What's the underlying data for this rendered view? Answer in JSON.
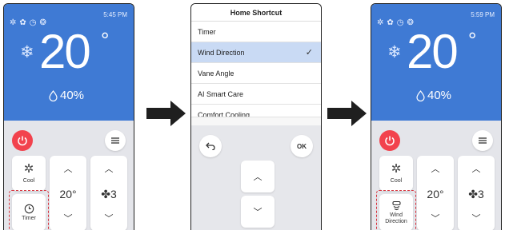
{
  "left_phone": {
    "time": "5:45 PM",
    "temperature": "20",
    "degree_symbol": "°",
    "humidity": "40%",
    "mode_label": "Cool",
    "shortcut_label": "Timer",
    "set_temp": "20°",
    "fan_speed": "3"
  },
  "middle_phone": {
    "title": "Home Shortcut",
    "items": [
      {
        "label": "Timer",
        "selected": false
      },
      {
        "label": "Wind Direction",
        "selected": true
      },
      {
        "label": "Vane Angle",
        "selected": false
      },
      {
        "label": "AI Smart Care",
        "selected": false
      },
      {
        "label": "Comfort Cooling",
        "selected": false
      }
    ],
    "check_glyph": "✓",
    "ok_label": "OK"
  },
  "right_phone": {
    "time": "5:59 PM",
    "temperature": "20",
    "degree_symbol": "°",
    "humidity": "40%",
    "mode_label": "Cool",
    "shortcut_label_line1": "Wind",
    "shortcut_label_line2": "Direction",
    "set_temp": "20°",
    "fan_speed": "3"
  },
  "colors": {
    "accent_blue": "#3f7ad4",
    "power_red": "#f2424d",
    "highlight_dash": "#d8353f",
    "selected_row": "#c9daf4"
  }
}
